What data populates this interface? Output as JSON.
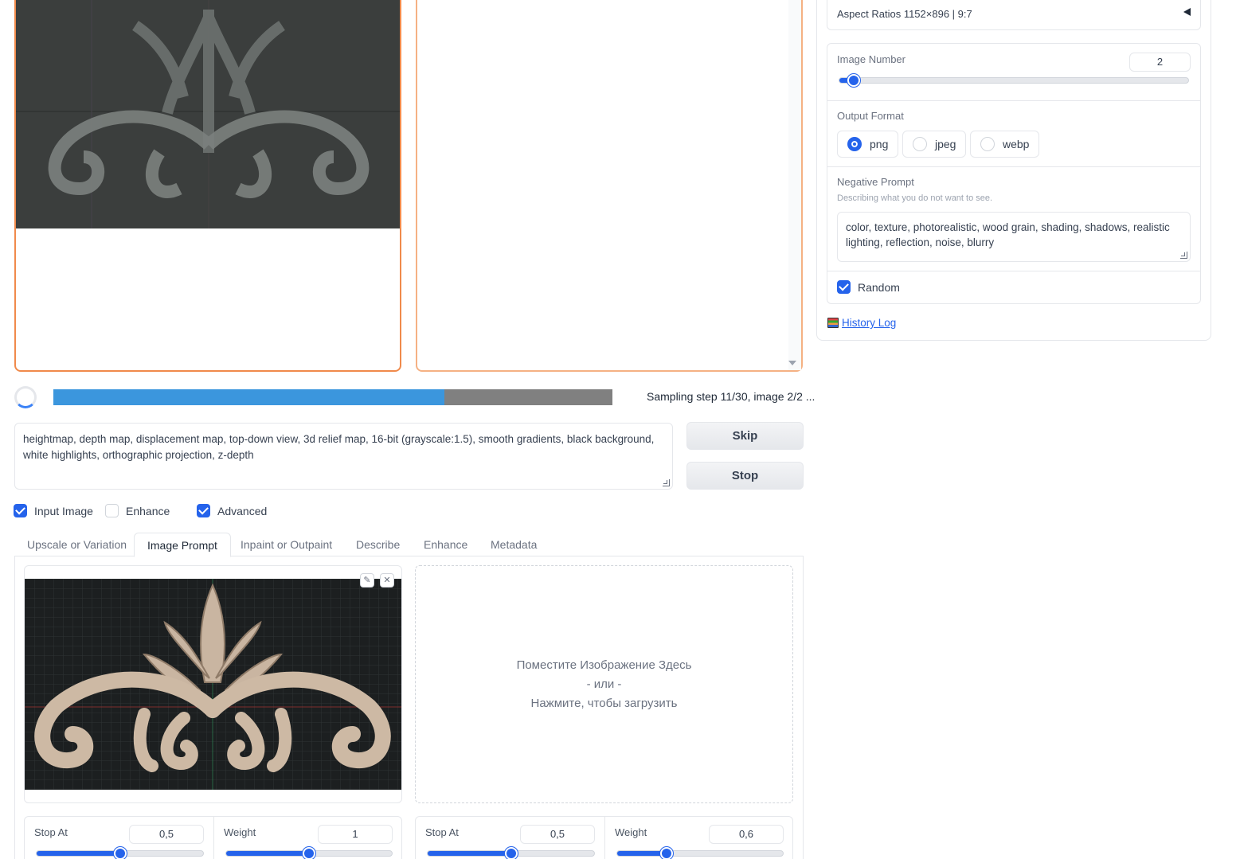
{
  "progress": {
    "fraction": 0.7,
    "status_text": "Sampling step 11/30, image 2/2 ..."
  },
  "prompt": {
    "value": "heightmap, depth map, displacement map, top-down view, 3d relief map, 16-bit (grayscale:1.5), smooth gradients, black background, white highlights, orthographic projection, z-depth"
  },
  "buttons": {
    "skip": "Skip",
    "stop": "Stop"
  },
  "checkboxes": {
    "input_image": {
      "label": "Input Image",
      "checked": true
    },
    "enhance": {
      "label": "Enhance",
      "checked": false
    },
    "advanced": {
      "label": "Advanced",
      "checked": true
    }
  },
  "tabs": [
    {
      "label": "Upscale or Variation",
      "active": false
    },
    {
      "label": "Image Prompt",
      "active": true
    },
    {
      "label": "Inpaint or Outpaint",
      "active": false
    },
    {
      "label": "Describe",
      "active": false
    },
    {
      "label": "Enhance",
      "active": false
    },
    {
      "label": "Metadata",
      "active": false
    }
  ],
  "image_prompt": {
    "drop_line1": "Поместите Изображение Здесь",
    "drop_line2": "- или -",
    "drop_line3": "Нажмите, чтобы загрузить",
    "slot1": {
      "stop_at_label": "Stop At",
      "stop_at": "0,5",
      "weight_label": "Weight",
      "weight": "1"
    },
    "slot2": {
      "stop_at_label": "Stop At",
      "stop_at": "0,5",
      "weight_label": "Weight",
      "weight": "0,6"
    }
  },
  "sidebar": {
    "aspect_ratios": "Aspect Ratios 1152×896 | 9:7",
    "image_number_label": "Image Number",
    "image_number": "2",
    "output_format_label": "Output Format",
    "formats": [
      {
        "label": "png",
        "selected": true
      },
      {
        "label": "jpeg",
        "selected": false
      },
      {
        "label": "webp",
        "selected": false
      }
    ],
    "negative_prompt_label": "Negative Prompt",
    "negative_prompt_hint": "Describing what you do not want to see.",
    "negative_prompt": "color, texture, photorealistic, wood grain, shading, shadows, realistic lighting, reflection, noise, blurry",
    "random_label": "Random",
    "history_log": "History Log"
  },
  "colors": {
    "accent": "#2563eb",
    "progress": "#3b96dd",
    "active_border": "#f08a4b"
  }
}
